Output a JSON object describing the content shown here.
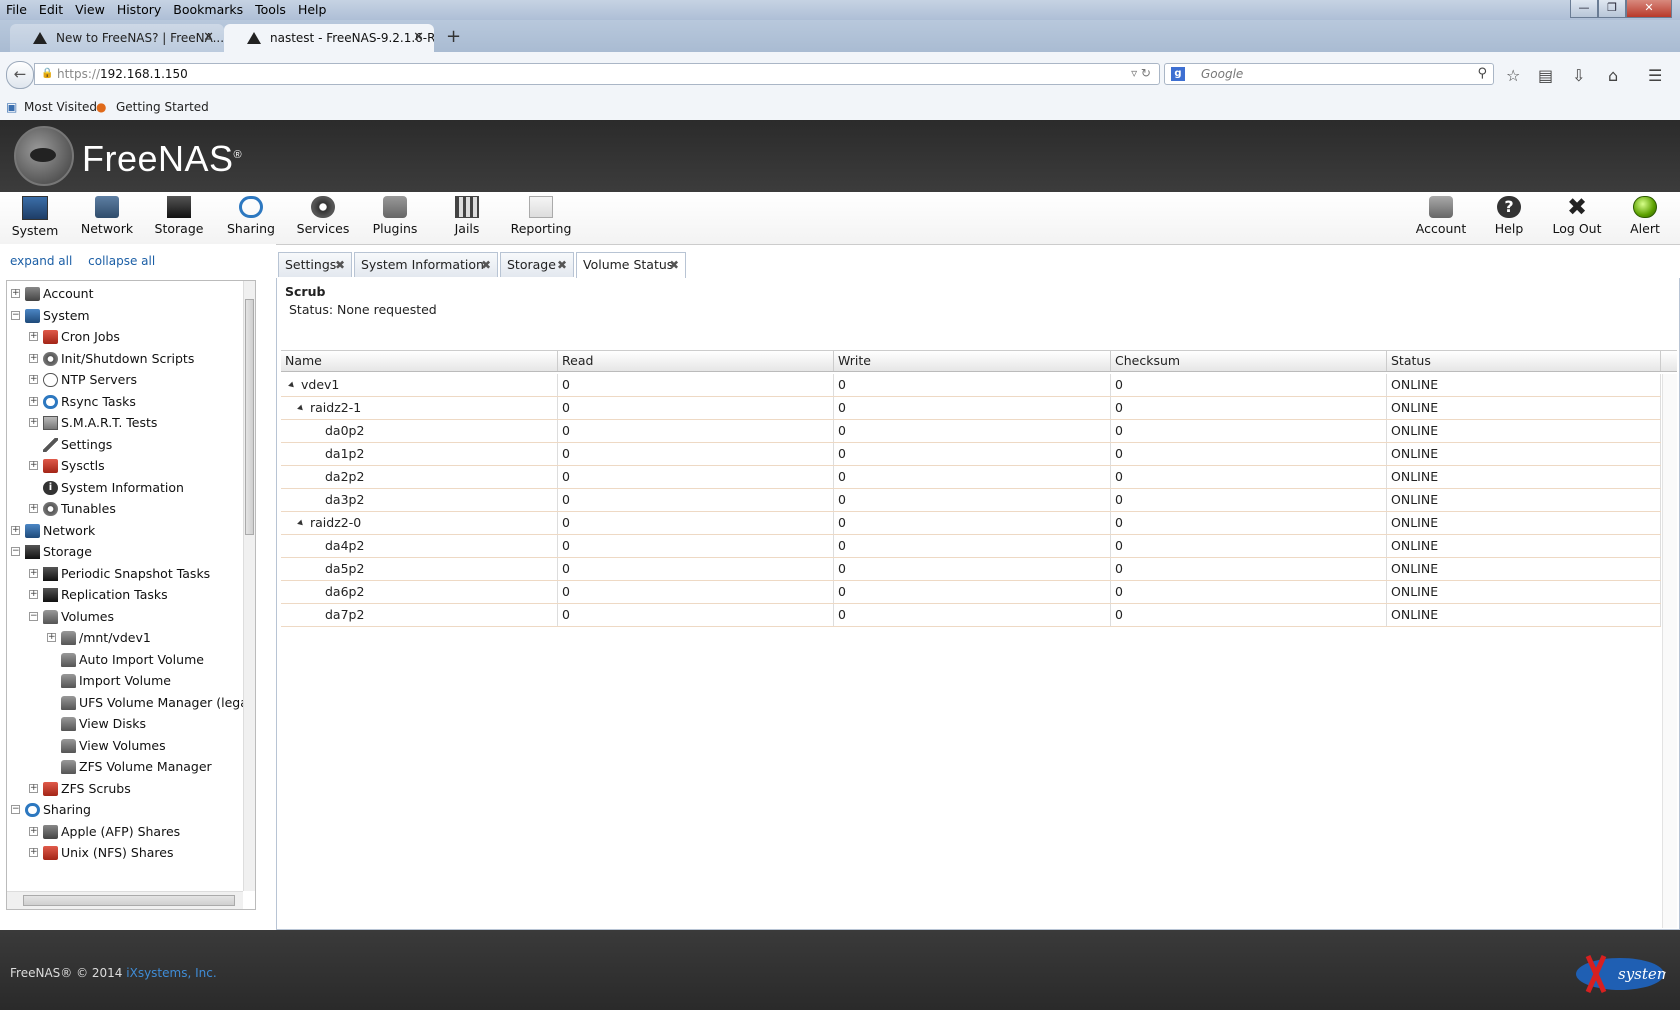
{
  "browser": {
    "menu": [
      "File",
      "Edit",
      "View",
      "History",
      "Bookmarks",
      "Tools",
      "Help"
    ],
    "tabs": [
      {
        "label": "New to FreeNAS? | FreeNA..."
      },
      {
        "label": "nastest - FreeNAS-9.2.1.6-R..."
      }
    ],
    "url_prefix": "https://",
    "url_host": "192.168.1.150",
    "search_placeholder": "Google",
    "bookmarks": [
      "Most Visited",
      "Getting Started"
    ]
  },
  "app": {
    "title": "FreeNAS",
    "toolbar_left": [
      {
        "label": "System",
        "icon": "system-icon"
      },
      {
        "label": "Network",
        "icon": "network-icon"
      },
      {
        "label": "Storage",
        "icon": "storage-icon"
      },
      {
        "label": "Sharing",
        "icon": "sharing-icon"
      },
      {
        "label": "Services",
        "icon": "services-icon"
      },
      {
        "label": "Plugins",
        "icon": "plugins-icon"
      },
      {
        "label": "Jails",
        "icon": "jails-icon"
      },
      {
        "label": "Reporting",
        "icon": "reporting-icon"
      }
    ],
    "toolbar_right": [
      {
        "label": "Account",
        "icon": "account-icon"
      },
      {
        "label": "Help",
        "icon": "help-icon"
      },
      {
        "label": "Log Out",
        "icon": "logout-icon"
      },
      {
        "label": "Alert",
        "icon": "alert-icon"
      }
    ]
  },
  "tree": {
    "expand_all": "expand all",
    "collapse_all": "collapse all",
    "items": [
      {
        "label": "Account",
        "level": 0,
        "exp": "+",
        "icon": "gray"
      },
      {
        "label": "System",
        "level": 0,
        "exp": "−",
        "icon": "blue"
      },
      {
        "label": "Cron Jobs",
        "level": 1,
        "exp": "+",
        "icon": "red"
      },
      {
        "label": "Init/Shutdown Scripts",
        "level": 1,
        "exp": "+",
        "icon": "gear"
      },
      {
        "label": "NTP Servers",
        "level": 1,
        "exp": "+",
        "icon": "clock"
      },
      {
        "label": "Rsync Tasks",
        "level": 1,
        "exp": "+",
        "icon": "sync"
      },
      {
        "label": "S.M.A.R.T. Tests",
        "level": 1,
        "exp": "+",
        "icon": "disk"
      },
      {
        "label": "Settings",
        "level": 1,
        "exp": "",
        "icon": "wrench"
      },
      {
        "label": "Sysctls",
        "level": 1,
        "exp": "+",
        "icon": "red"
      },
      {
        "label": "System Information",
        "level": 1,
        "exp": "",
        "icon": "info"
      },
      {
        "label": "Tunables",
        "level": 1,
        "exp": "+",
        "icon": "gear"
      },
      {
        "label": "Network",
        "level": 0,
        "exp": "+",
        "icon": "blue"
      },
      {
        "label": "Storage",
        "level": 0,
        "exp": "−",
        "icon": "dark"
      },
      {
        "label": "Periodic Snapshot Tasks",
        "level": 1,
        "exp": "+",
        "icon": "dark"
      },
      {
        "label": "Replication Tasks",
        "level": 1,
        "exp": "+",
        "icon": "dark"
      },
      {
        "label": "Volumes",
        "level": 1,
        "exp": "−",
        "icon": "db"
      },
      {
        "label": "/mnt/vdev1",
        "level": 2,
        "exp": "+",
        "icon": "db"
      },
      {
        "label": "Auto Import Volume",
        "level": 2,
        "exp": "",
        "icon": "db"
      },
      {
        "label": "Import Volume",
        "level": 2,
        "exp": "",
        "icon": "db"
      },
      {
        "label": "UFS Volume Manager (legacy)",
        "level": 2,
        "exp": "",
        "icon": "db"
      },
      {
        "label": "View Disks",
        "level": 2,
        "exp": "",
        "icon": "db"
      },
      {
        "label": "View Volumes",
        "level": 2,
        "exp": "",
        "icon": "db"
      },
      {
        "label": "ZFS Volume Manager",
        "level": 2,
        "exp": "",
        "icon": "db"
      },
      {
        "label": "ZFS Scrubs",
        "level": 1,
        "exp": "+",
        "icon": "red"
      },
      {
        "label": "Sharing",
        "level": 0,
        "exp": "−",
        "icon": "sync"
      },
      {
        "label": "Apple (AFP) Shares",
        "level": 1,
        "exp": "+",
        "icon": "gray"
      },
      {
        "label": "Unix (NFS) Shares",
        "level": 1,
        "exp": "+",
        "icon": "red"
      }
    ]
  },
  "content_tabs": [
    {
      "label": "Settings"
    },
    {
      "label": "System Information"
    },
    {
      "label": "Storage"
    },
    {
      "label": "Volume Status",
      "active": true
    }
  ],
  "scrub": {
    "title": "Scrub",
    "status": "Status: None requested"
  },
  "grid": {
    "columns": [
      "Name",
      "Read",
      "Write",
      "Checksum",
      "Status"
    ],
    "rows": [
      {
        "name": "vdev1",
        "indent": 0,
        "tri": true,
        "read": "0",
        "write": "0",
        "checksum": "0",
        "status": "ONLINE"
      },
      {
        "name": "raidz2-1",
        "indent": 1,
        "tri": true,
        "read": "0",
        "write": "0",
        "checksum": "0",
        "status": "ONLINE"
      },
      {
        "name": "da0p2",
        "indent": 2,
        "tri": false,
        "read": "0",
        "write": "0",
        "checksum": "0",
        "status": "ONLINE"
      },
      {
        "name": "da1p2",
        "indent": 2,
        "tri": false,
        "read": "0",
        "write": "0",
        "checksum": "0",
        "status": "ONLINE"
      },
      {
        "name": "da2p2",
        "indent": 2,
        "tri": false,
        "read": "0",
        "write": "0",
        "checksum": "0",
        "status": "ONLINE"
      },
      {
        "name": "da3p2",
        "indent": 2,
        "tri": false,
        "read": "0",
        "write": "0",
        "checksum": "0",
        "status": "ONLINE"
      },
      {
        "name": "raidz2-0",
        "indent": 1,
        "tri": true,
        "read": "0",
        "write": "0",
        "checksum": "0",
        "status": "ONLINE"
      },
      {
        "name": "da4p2",
        "indent": 2,
        "tri": false,
        "read": "0",
        "write": "0",
        "checksum": "0",
        "status": "ONLINE"
      },
      {
        "name": "da5p2",
        "indent": 2,
        "tri": false,
        "read": "0",
        "write": "0",
        "checksum": "0",
        "status": "ONLINE"
      },
      {
        "name": "da6p2",
        "indent": 2,
        "tri": false,
        "read": "0",
        "write": "0",
        "checksum": "0",
        "status": "ONLINE"
      },
      {
        "name": "da7p2",
        "indent": 2,
        "tri": false,
        "read": "0",
        "write": "0",
        "checksum": "0",
        "status": "ONLINE"
      }
    ]
  },
  "footer": {
    "text": "FreeNAS® © 2014",
    "link": "iXsystems, Inc.",
    "logo_text": "systems"
  }
}
